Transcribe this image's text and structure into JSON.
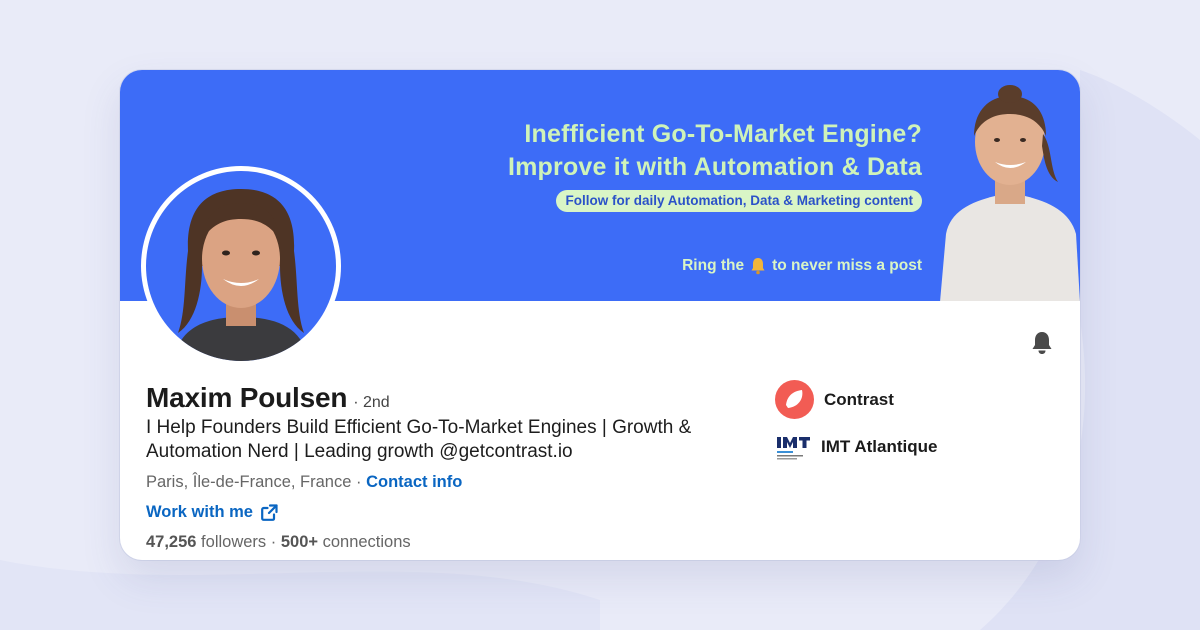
{
  "banner": {
    "headline_line1": "Inefficient Go-To-Market Engine?",
    "headline_line2": "Improve it with Automation & Data",
    "pill": "Follow for daily Automation, Data & Marketing content",
    "ring_before": "Ring the",
    "ring_after": "to never miss a post",
    "ring_icon": "bell-emoji"
  },
  "profile": {
    "name": "Maxim Poulsen",
    "degree": "· 2nd",
    "headline": "I Help Founders Build Efficient Go-To-Market Engines | Growth & Automation Nerd | Leading growth @getcontrast.io",
    "location": "Paris, Île-de-France, France",
    "separator": " · ",
    "contact_info": "Contact info",
    "work_with_me": "Work with me",
    "followers_count": "47,256",
    "followers_label": " followers",
    "stats_separator": "  · ",
    "connections_count": "500+",
    "connections_label": " connections"
  },
  "companies": [
    {
      "name": "Contrast",
      "icon": "contrast-logo"
    },
    {
      "name": "IMT Atlantique",
      "icon": "imt-logo"
    }
  ],
  "icons": {
    "notify": "bell-icon",
    "external": "external-link-icon"
  },
  "colors": {
    "banner": "#3d6cf7",
    "banner_text": "#cff3b9",
    "link": "#0a66c2",
    "background": "#e9ebf8",
    "contrast_brand": "#f25c54"
  }
}
